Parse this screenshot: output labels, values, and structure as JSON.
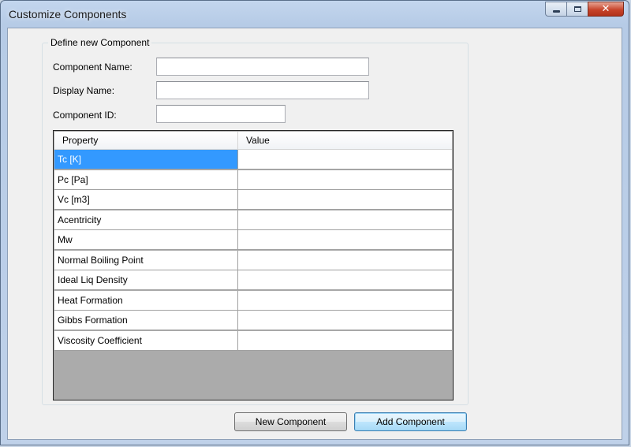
{
  "window": {
    "title": "Customize Components",
    "minimize_glyph": "",
    "maximize_glyph": "",
    "close_glyph": "✕"
  },
  "group": {
    "title": "Define new Component",
    "fields": {
      "component_name": {
        "label": "Component Name:",
        "value": ""
      },
      "display_name": {
        "label": "Display Name:",
        "value": ""
      },
      "component_id": {
        "label": "Component ID:",
        "value": ""
      }
    }
  },
  "grid": {
    "columns": [
      "Property",
      "Value"
    ],
    "rows": [
      {
        "property": "Tc [K]",
        "value": ""
      },
      {
        "property": "Pc [Pa]",
        "value": ""
      },
      {
        "property": "Vc [m3]",
        "value": ""
      },
      {
        "property": "Acentricity",
        "value": ""
      },
      {
        "property": "Mw",
        "value": ""
      },
      {
        "property": "Normal Boiling Point",
        "value": ""
      },
      {
        "property": "Ideal Liq Density",
        "value": ""
      },
      {
        "property": "Heat Formation",
        "value": ""
      },
      {
        "property": "Gibbs Formation",
        "value": ""
      },
      {
        "property": "Viscosity Coefficient",
        "value": ""
      }
    ],
    "selected_row": 0
  },
  "buttons": {
    "new_component": "New Component",
    "add_component": "Add Component"
  },
  "colors": {
    "selection": "#3399ff",
    "grid_empty": "#ababab"
  }
}
